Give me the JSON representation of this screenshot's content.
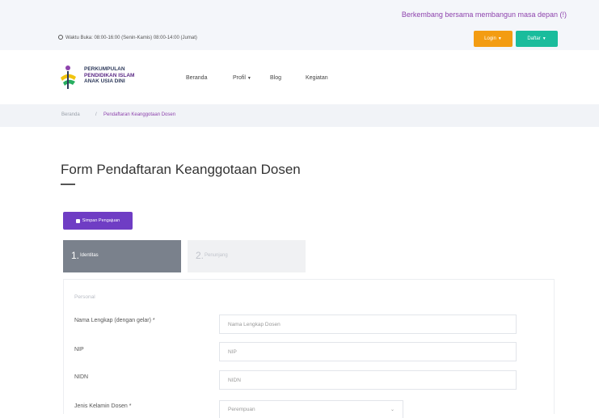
{
  "topbar": {
    "tagline": "Berkembang bersama membangun masa depan (!)",
    "hours": "Waktu Buka: 08:00-16:00 (Senin-Kamis) 08:00-14:00 (Jumat)",
    "login_label": "Login",
    "register_label": "Daftar"
  },
  "brand": {
    "line1": "PERKUMPULAN",
    "line2": "PENDIDIKAN ISLAM",
    "line3": "ANAK USIA DINI"
  },
  "nav": [
    {
      "label": "Beranda"
    },
    {
      "label": "Profil"
    },
    {
      "label": "Blog"
    },
    {
      "label": "Kegiatan"
    }
  ],
  "breadcrumb": {
    "home": "Beranda",
    "separator": "/",
    "current": "Pendaftaran Keanggotaan Dosen"
  },
  "page": {
    "title": "Form Pendaftaran Keanggotaan Dosen"
  },
  "save_button": {
    "label": "Simpan Pengajuan"
  },
  "steps": [
    {
      "number": "1.",
      "label": "Identitas"
    },
    {
      "number": "2.",
      "label": "Penunjang"
    }
  ],
  "form": {
    "section": "Personal",
    "fields": [
      {
        "label": "Nama Lengkap (dengan gelar) *",
        "placeholder": "Nama Lengkap Dosen"
      },
      {
        "label": "NIP",
        "placeholder": "NIP"
      },
      {
        "label": "NIDN",
        "placeholder": "NIDN"
      },
      {
        "label": "Jenis Kelamin Dosen *",
        "placeholder": "Perempuan"
      }
    ]
  },
  "colors": {
    "accent_purple": "#6f3dc4",
    "login_orange": "#f39c12",
    "register_teal": "#1abc9c",
    "active_step": "#7a818c"
  }
}
